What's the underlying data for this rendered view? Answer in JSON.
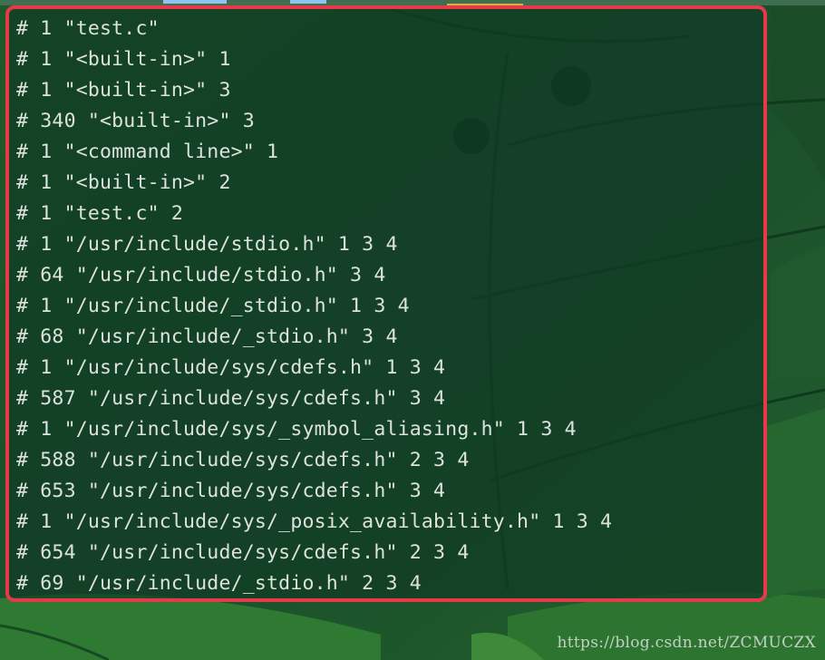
{
  "terminal": {
    "lines": [
      "# 1 \"test.c\"",
      "# 1 \"<built-in>\" 1",
      "# 1 \"<built-in>\" 3",
      "# 340 \"<built-in>\" 3",
      "# 1 \"<command line>\" 1",
      "# 1 \"<built-in>\" 2",
      "# 1 \"test.c\" 2",
      "# 1 \"/usr/include/stdio.h\" 1 3 4",
      "# 64 \"/usr/include/stdio.h\" 3 4",
      "# 1 \"/usr/include/_stdio.h\" 1 3 4",
      "# 68 \"/usr/include/_stdio.h\" 3 4",
      "# 1 \"/usr/include/sys/cdefs.h\" 1 3 4",
      "# 587 \"/usr/include/sys/cdefs.h\" 3 4",
      "# 1 \"/usr/include/sys/_symbol_aliasing.h\" 1 3 4",
      "# 588 \"/usr/include/sys/cdefs.h\" 2 3 4",
      "# 653 \"/usr/include/sys/cdefs.h\" 3 4",
      "# 1 \"/usr/include/sys/_posix_availability.h\" 1 3 4",
      "# 654 \"/usr/include/sys/cdefs.h\" 2 3 4",
      "# 69 \"/usr/include/_stdio.h\" 2 3 4"
    ]
  },
  "watermark": "https://blog.csdn.net/ZCMUCZX",
  "colors": {
    "highlight_border": "#e8394a",
    "terminal_text": "#dde2dd",
    "wallpaper_green": "#1f5a2c"
  }
}
